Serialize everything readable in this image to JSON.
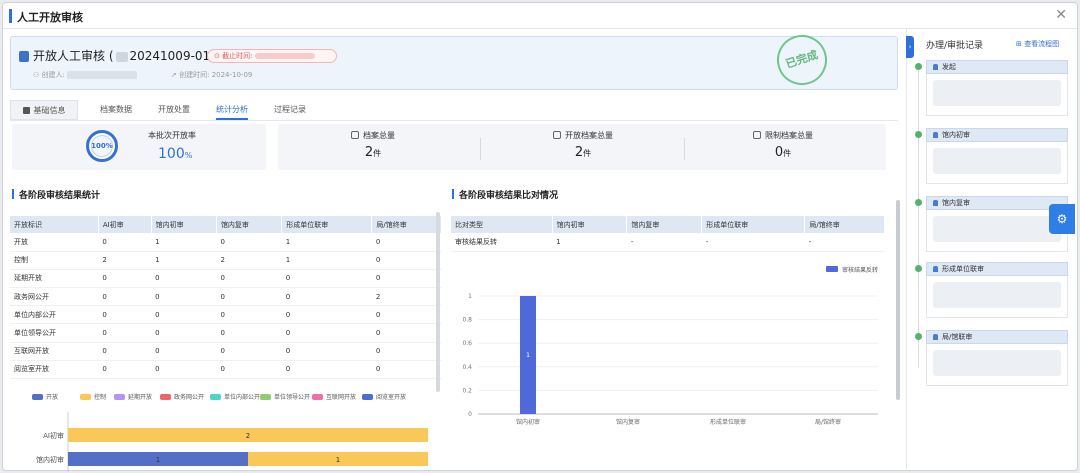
{
  "dialog": {
    "title": "人工开放审核",
    "close_icon": "close-icon"
  },
  "header": {
    "title_prefix": "开放人工审核 (",
    "title_suffix": "20241009-01)",
    "deadline_label": "⊙ 截止时间:",
    "creator_label": "创建人:",
    "created_label": "创建时间:",
    "created_value": "2024-10-09",
    "stamp": "已完成"
  },
  "tabs": [
    {
      "label": "基础信息"
    },
    {
      "label": "档案数据"
    },
    {
      "label": "开放处置"
    },
    {
      "label": "统计分析",
      "active": true
    },
    {
      "label": "过程记录"
    }
  ],
  "summary": {
    "ring_text": "100%",
    "rate_label": "本批次开放率",
    "rate_value": "100",
    "rate_unit": "%",
    "kpis": [
      {
        "label": "档案总量",
        "value": "2",
        "unit": "件"
      },
      {
        "label": "开放档案总量",
        "value": "2",
        "unit": "件"
      },
      {
        "label": "限制档案总量",
        "value": "0",
        "unit": "件"
      }
    ]
  },
  "left_section": {
    "title": "各阶段审核结果统计",
    "headers": [
      "开放标识",
      "AI初审",
      "馆内初审",
      "馆内复审",
      "形成单位联审",
      "局/馆终审"
    ],
    "rows": [
      [
        "开放",
        "0",
        "1",
        "0",
        "1",
        "0"
      ],
      [
        "控制",
        "2",
        "1",
        "2",
        "1",
        "0"
      ],
      [
        "延期开放",
        "0",
        "0",
        "0",
        "0",
        "0"
      ],
      [
        "政务网公开",
        "0",
        "0",
        "0",
        "0",
        "2"
      ],
      [
        "单位内部公开",
        "0",
        "0",
        "0",
        "0",
        "0"
      ],
      [
        "单位领导公开",
        "0",
        "0",
        "0",
        "0",
        "0"
      ],
      [
        "互联网开放",
        "0",
        "0",
        "0",
        "0",
        "0"
      ],
      [
        "阅览室开放",
        "0",
        "0",
        "0",
        "0",
        "0"
      ]
    ]
  },
  "right_section": {
    "title": "各阶段审核结果比对情况",
    "headers": [
      "比对类型",
      "馆内初审",
      "馆内复审",
      "形成单位联审",
      "局/馆终审"
    ],
    "rows": [
      [
        "审核结果反转",
        "1",
        "-",
        "-",
        "-"
      ]
    ]
  },
  "chart_data": [
    {
      "type": "bar",
      "orientation": "horizontal",
      "stacked": true,
      "categories": [
        "AI初审",
        "馆内初审"
      ],
      "series": [
        {
          "name": "开放",
          "color": "#5470c6",
          "values": [
            0,
            1
          ]
        },
        {
          "name": "控制",
          "color": "#fac858",
          "values": [
            2,
            1
          ]
        },
        {
          "name": "延期开放",
          "color": "#b197f0",
          "values": [
            0,
            0
          ]
        },
        {
          "name": "政务网公开",
          "color": "#ee6666",
          "values": [
            0,
            0
          ]
        },
        {
          "name": "单位内部公开",
          "color": "#4fd5c8",
          "values": [
            0,
            0
          ]
        },
        {
          "name": "单位领导公开",
          "color": "#91cc75",
          "values": [
            0,
            0
          ]
        },
        {
          "name": "互联网开放",
          "color": "#f06ea9",
          "values": [
            0,
            0
          ]
        },
        {
          "name": "阅览室开放",
          "color": "#4a6fd0",
          "values": [
            0,
            0
          ]
        }
      ],
      "legend": "top"
    },
    {
      "type": "bar",
      "categories": [
        "馆内初审",
        "馆内复审",
        "形成单位联审",
        "局/馆终审"
      ],
      "series": [
        {
          "name": "审核结果反转",
          "color": "#4f6ad8",
          "values": [
            1,
            0,
            0,
            0
          ]
        }
      ],
      "y_ticks": [
        "0",
        "0.2",
        "0.4",
        "0.6",
        "0.8",
        "1"
      ],
      "ylim": [
        0,
        1
      ],
      "legend": "top-right"
    }
  ],
  "sidebar": {
    "title": "办理/审批记录",
    "link": "查看流程图",
    "steps": [
      {
        "label": "发起"
      },
      {
        "label": "馆内初审"
      },
      {
        "label": "馆内复审"
      },
      {
        "label": "形成单位联审"
      },
      {
        "label": "局/馆联审"
      }
    ]
  }
}
